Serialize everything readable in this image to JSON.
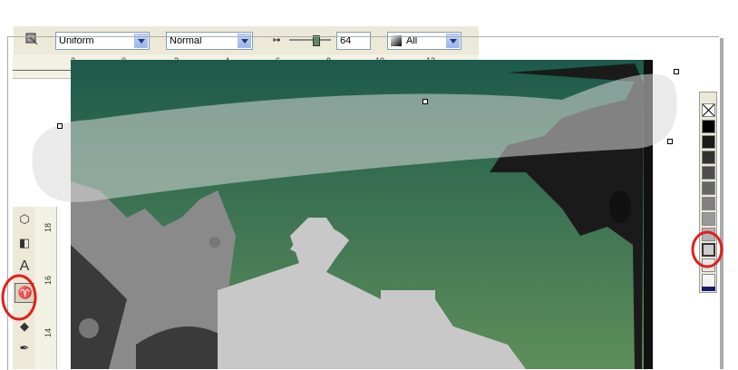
{
  "propertybar": {
    "fill_type": "Uniform",
    "blend_mode": "Normal",
    "transparency_value": "64",
    "apply_to": "All"
  },
  "ruler_h": {
    "labels": [
      "2",
      "0",
      "2",
      "4",
      "6",
      "8",
      "10",
      "12"
    ]
  },
  "ruler_v": {
    "labels": [
      "18",
      "16",
      "14"
    ]
  },
  "colors": {
    "accent_highlight": "#e0201c",
    "sky": "#2e6b52",
    "moon": "#e6e62e"
  }
}
